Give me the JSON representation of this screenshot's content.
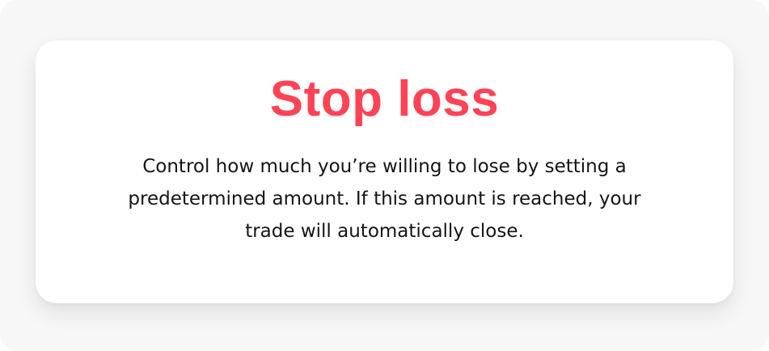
{
  "card": {
    "title": "Stop loss",
    "description_lines": [
      "Control how much you’re willing to lose by setting a",
      "predetermined amount. If this amount is reached, your",
      "trade will automatically close."
    ]
  },
  "colors": {
    "title": "#ff4357",
    "text": "#141414",
    "card_background": "#ffffff",
    "page_background": "#f7f7f7"
  }
}
